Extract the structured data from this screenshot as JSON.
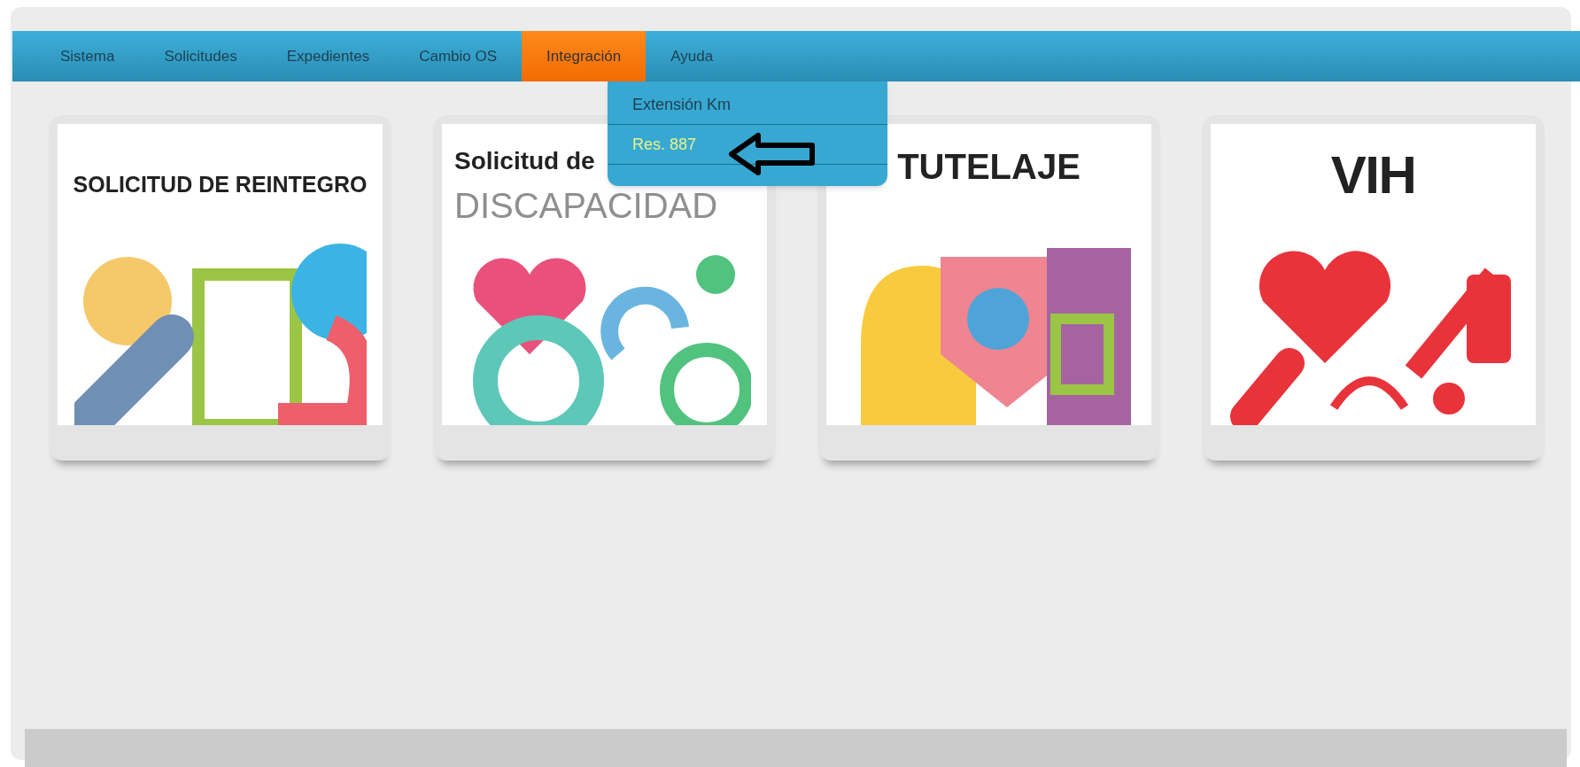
{
  "menu": [
    {
      "label": "Sistema",
      "selected": false
    },
    {
      "label": "Solicitudes",
      "selected": false
    },
    {
      "label": "Expedientes",
      "selected": false
    },
    {
      "label": "Cambio OS",
      "selected": false
    },
    {
      "label": "Integración",
      "selected": true
    },
    {
      "label": "Ayuda",
      "selected": false
    }
  ],
  "dropdown": [
    {
      "label": "Extensión Km",
      "selected": false
    },
    {
      "label": "Res. 887",
      "selected": true
    }
  ],
  "cards": [
    {
      "kind": "reintegro",
      "title": [
        "SOLICITUD DE REINTEGRO"
      ]
    },
    {
      "kind": "discapacidad",
      "title": [
        "Solicitud de",
        "DISCAPACIDAD"
      ]
    },
    {
      "kind": "tutelaje",
      "title": [
        "TUTELAJE"
      ]
    },
    {
      "kind": "vih",
      "title": [
        "VIH"
      ]
    }
  ]
}
